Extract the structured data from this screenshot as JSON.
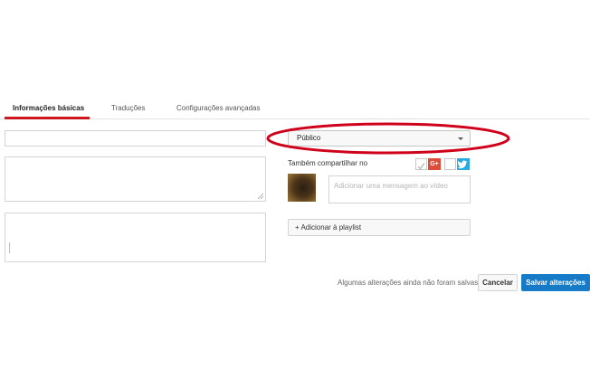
{
  "tabs": [
    {
      "label": "Informações básicas",
      "active": true
    },
    {
      "label": "Traduções",
      "active": false
    },
    {
      "label": "Configurações avançadas",
      "active": false
    }
  ],
  "basic_info": {
    "title_value": "",
    "description_value": "",
    "tags_value": ""
  },
  "privacy": {
    "selected": "Público"
  },
  "share": {
    "label": "Também compartilhar no",
    "gplus_label": "G+",
    "message_placeholder": "Adicionar uma mensagem ao vídeo"
  },
  "playlist": {
    "button_label": "+ Adicionar à playlist"
  },
  "footer": {
    "unsaved_message": "Algumas alterações ainda não foram salvas.",
    "cancel_label": "Cancelar",
    "save_label": "Salvar alterações"
  },
  "colors": {
    "tab_underline": "#cc181e",
    "annotation": "#d0021b",
    "save_button": "#167ac6",
    "gplus": "#dd4b39",
    "twitter": "#2aa9e0"
  },
  "icons": [
    "dropdown-arrow-icon",
    "check-icon",
    "google-plus-icon",
    "twitter-icon",
    "resize-grip-icon"
  ]
}
